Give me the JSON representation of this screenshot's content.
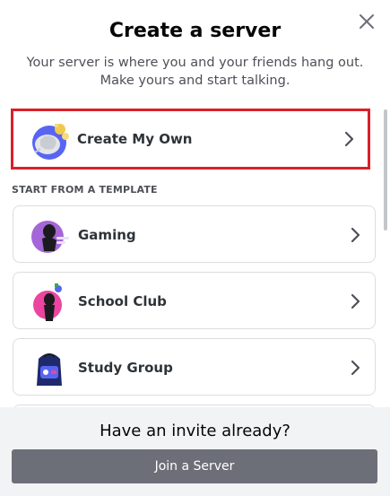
{
  "modal": {
    "title": "Create a server",
    "subtitle": "Your server is where you and your friends hang out. Make yours and start talking.",
    "close_icon": "close-icon"
  },
  "primary_option": {
    "label": "Create My Own",
    "icon": "create-own-illustration-icon",
    "highlight_color": "#d9202a"
  },
  "template_section": {
    "heading": "START FROM A TEMPLATE",
    "items": [
      {
        "label": "Gaming",
        "icon": "gaming-illustration-icon"
      },
      {
        "label": "School Club",
        "icon": "school-club-illustration-icon"
      },
      {
        "label": "Study Group",
        "icon": "study-group-illustration-icon"
      }
    ]
  },
  "footer": {
    "prompt": "Have an invite already?",
    "join_button_label": "Join a Server"
  },
  "colors": {
    "button_bg": "#6d6f78",
    "footer_bg": "#f2f3f5",
    "border": "#dcdde0"
  }
}
